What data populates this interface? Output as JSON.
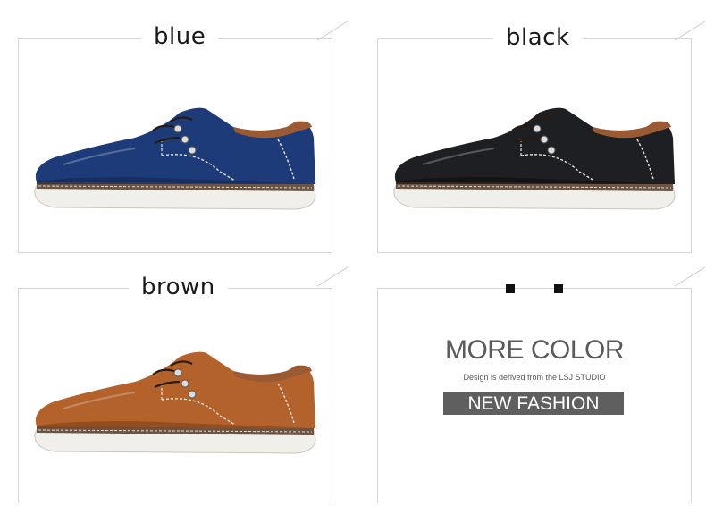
{
  "panels": {
    "blue": {
      "label": "blue",
      "upper_color": "#1d3b78",
      "upper_shade": "#122754"
    },
    "black": {
      "label": "black",
      "upper_color": "#1e1f22",
      "upper_shade": "#0b0b0c"
    },
    "brown": {
      "label": "brown",
      "upper_color": "#b4622c",
      "upper_shade": "#7e3f18"
    }
  },
  "promo": {
    "headline": "MORE COLOR",
    "subline": "Design is derived from the   LSJ  STUDIO",
    "badge": "NEW FASHION"
  }
}
